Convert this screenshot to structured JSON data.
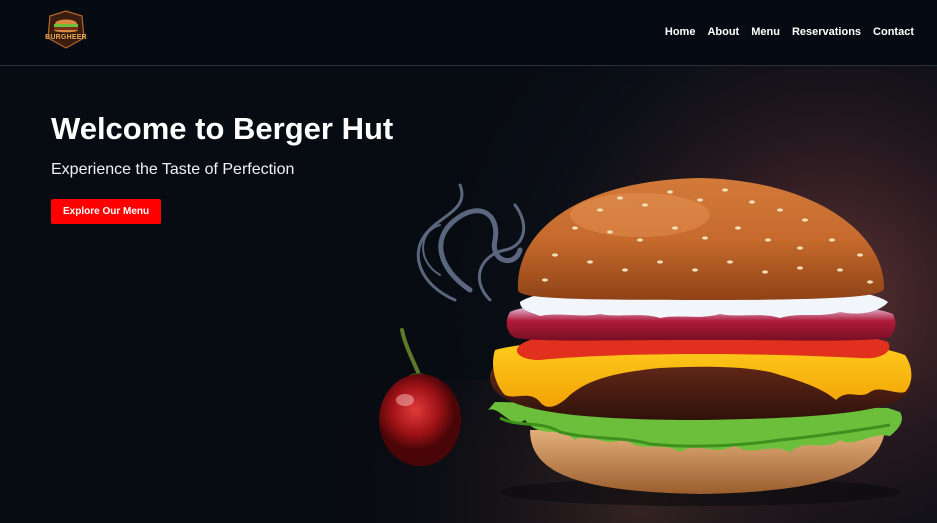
{
  "header": {
    "logo": {
      "text": "BURGHEER",
      "icon": "burger-logo-icon"
    },
    "nav": [
      {
        "label": "Home"
      },
      {
        "label": "About"
      },
      {
        "label": "Menu"
      },
      {
        "label": "Reservations"
      },
      {
        "label": "Contact"
      }
    ]
  },
  "hero": {
    "title": "Welcome to Berger Hut",
    "subtitle": "Experience the Taste of Perfection",
    "cta_label": "Explore Our Menu",
    "image": "burger-photo"
  },
  "colors": {
    "background": "#070b12",
    "accent": "#ff0000",
    "text": "#ffffff",
    "divider": "#2a2f38"
  }
}
